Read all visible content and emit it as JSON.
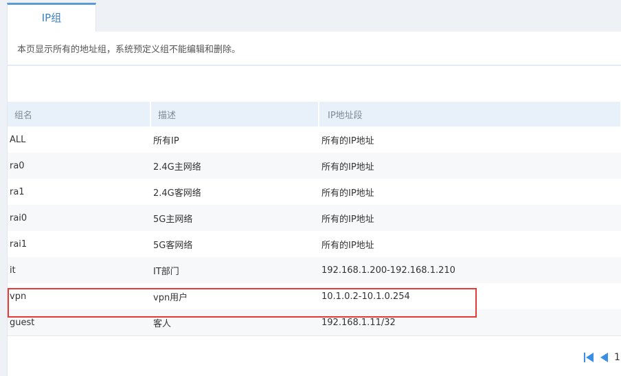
{
  "tab": {
    "label": "IP组"
  },
  "notice": {
    "text": "本页显示所有的地址组，系统预定义组不能编辑和删除。"
  },
  "table": {
    "columns": [
      "组名",
      "描述",
      "IP地址段"
    ],
    "rows": [
      {
        "name": "ALL",
        "desc": "所有IP",
        "range": "所有的IP地址"
      },
      {
        "name": "ra0",
        "desc": "2.4G主网络",
        "range": "所有的IP地址"
      },
      {
        "name": "ra1",
        "desc": "2.4G客网络",
        "range": "所有的IP地址"
      },
      {
        "name": "rai0",
        "desc": "5G主网络",
        "range": "所有的IP地址"
      },
      {
        "name": "rai1",
        "desc": "5G客网络",
        "range": "所有的IP地址"
      },
      {
        "name": "it",
        "desc": "IT部门",
        "range": "192.168.1.200-192.168.1.210"
      },
      {
        "name": "vpn",
        "desc": "vpn用户",
        "range": "10.1.0.2-10.1.0.254"
      },
      {
        "name": "guest",
        "desc": "客人",
        "range": "192.168.1.11/32"
      }
    ]
  },
  "pager": {
    "page": "1",
    "first_icon": "first-page-icon",
    "prev_icon": "prev-page-icon",
    "accent_color": "#3a8ee6"
  },
  "highlight_color": "#e53935"
}
